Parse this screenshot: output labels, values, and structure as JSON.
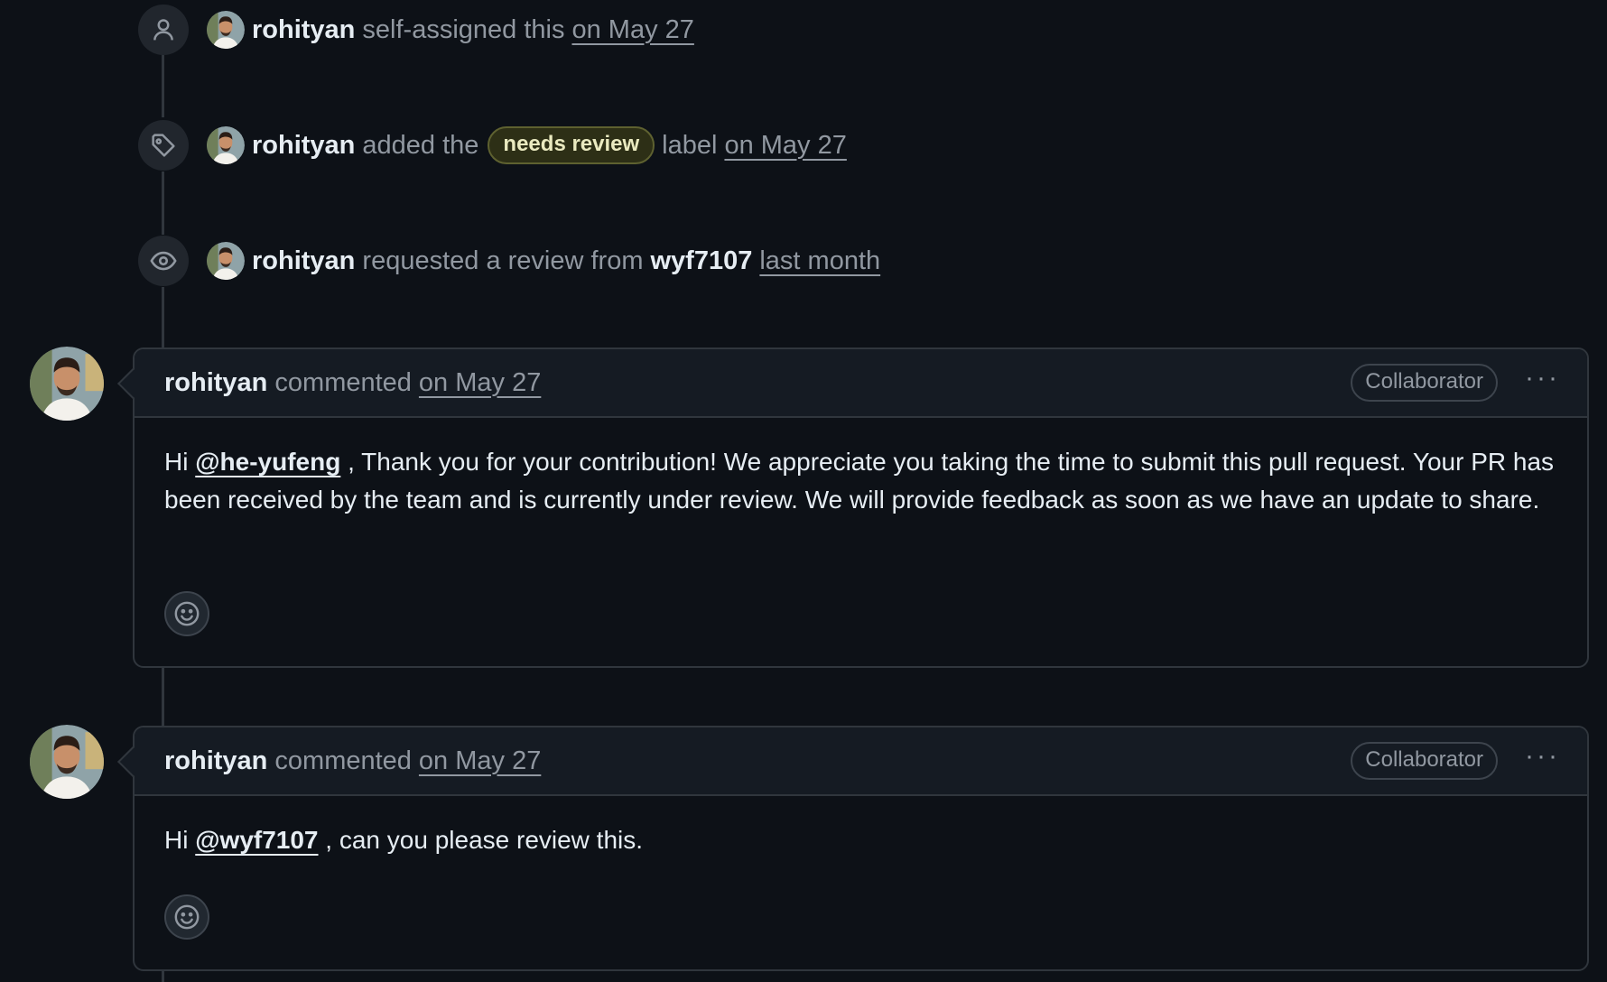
{
  "timeline": {
    "events": [
      {
        "icon": "person-icon",
        "actor": "rohityan",
        "text": "self-assigned this",
        "time": "on May 27"
      },
      {
        "icon": "tag-icon",
        "actor": "rohityan",
        "text_before": "added the",
        "label": "needs review",
        "text_after": "label",
        "time": "on May 27"
      },
      {
        "icon": "eye-icon",
        "actor": "rohityan",
        "text": "requested a review from",
        "reviewer": "wyf7107",
        "time": "last month"
      }
    ],
    "comments": [
      {
        "author": "rohityan",
        "action": "commented",
        "time": "on May 27",
        "role": "Collaborator",
        "menu": "···",
        "body_prefix": "Hi ",
        "mention": "@he-yufeng",
        "body_suffix": " , Thank you for your contribution! We appreciate you taking the time to submit this pull request. Your PR has been received by the team and is currently under review. We will provide feedback as soon as we have an update to share."
      },
      {
        "author": "rohityan",
        "action": "commented",
        "time": "on May 27",
        "role": "Collaborator",
        "menu": "···",
        "body_prefix": "Hi ",
        "mention": "@wyf7107",
        "body_suffix": " , can you please review this."
      }
    ]
  },
  "colors": {
    "background": "#0d1117",
    "border": "#30363d",
    "header_bg": "#151b23",
    "muted_text": "#9198a1",
    "label_bg": "#2d2f16",
    "label_text": "#eaeac0"
  }
}
